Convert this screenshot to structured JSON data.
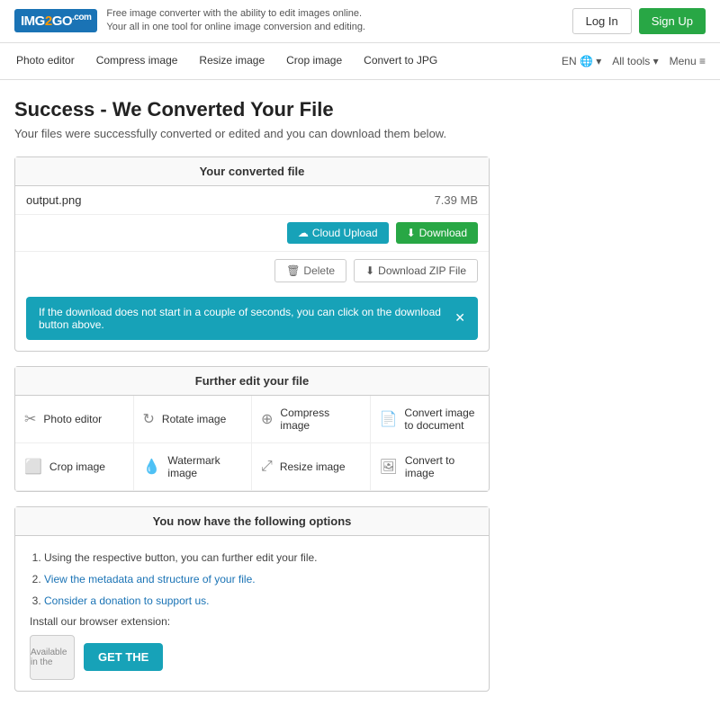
{
  "header": {
    "logo_text": "IMG2GO",
    "logo_highlight": "2",
    "tagline_line1": "Free image converter with the ability to edit images online.",
    "tagline_line2": "Your all in one tool for online image conversion and editing.",
    "login_label": "Log In",
    "signup_label": "Sign Up"
  },
  "nav": {
    "items": [
      {
        "label": "Photo editor"
      },
      {
        "label": "Compress image"
      },
      {
        "label": "Resize image"
      },
      {
        "label": "Crop image"
      },
      {
        "label": "Convert to JPG"
      }
    ],
    "right_items": [
      {
        "label": "EN 🌐 ▾"
      },
      {
        "label": "All tools ▾"
      },
      {
        "label": "Menu ≡"
      }
    ]
  },
  "page": {
    "title": "Success - We Converted Your File",
    "subtitle": "Your files were successfully converted or edited and you can download them below."
  },
  "converted_file": {
    "section_title": "Your converted file",
    "file_name": "output.png",
    "file_size": "7.39 MB",
    "btn_cloud_upload": "Cloud Upload",
    "btn_download": "Download",
    "btn_delete": "Delete",
    "btn_zip": "Download ZIP File",
    "alert_text": "If the download does not start in a couple of seconds, you can click on the download button above.",
    "alert_close": "✕"
  },
  "further_edit": {
    "section_title": "Further edit your file",
    "tools": [
      {
        "icon": "✂",
        "label": "Photo editor"
      },
      {
        "icon": "↻",
        "label": "Rotate image"
      },
      {
        "icon": "⊕",
        "label": "Compress image"
      },
      {
        "icon": "📄",
        "label": "Convert image to document"
      },
      {
        "icon": "⬜",
        "label": "Crop image"
      },
      {
        "icon": "💧",
        "label": "Watermark image"
      },
      {
        "icon": "⤢",
        "label": "Resize image"
      },
      {
        "icon": "🖼",
        "label": "Convert to image"
      }
    ]
  },
  "options": {
    "section_title": "You now have the following options",
    "items": [
      {
        "text": "Using the respective button, you can further edit your file.",
        "link": false
      },
      {
        "text": "View the metadata and structure of your file.",
        "link": true
      },
      {
        "text": "Consider a donation to support us.",
        "link": true
      }
    ],
    "extension_label": "Install our browser extension:",
    "ext_item4_label": "Available in the",
    "ext_btn_label": "GET THE"
  }
}
